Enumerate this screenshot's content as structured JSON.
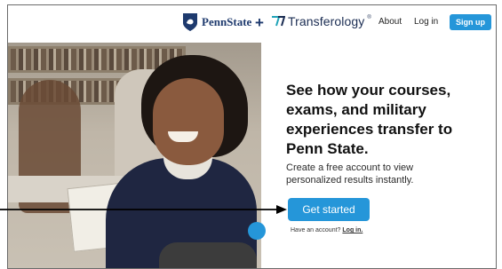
{
  "header": {
    "partner_name": "PennState",
    "plus": "+",
    "brand_name": "Transferology",
    "brand_mark": "®",
    "nav": {
      "about": "About",
      "login": "Log in"
    },
    "signup_label": "Sign up"
  },
  "hero": {
    "headline": "See how your courses, exams, and military experiences transfer to Penn State.",
    "subtext": "Create a free account to view personalized results instantly.",
    "cta_label": "Get started",
    "have_account": "Have an account?",
    "login_link": "Log in."
  },
  "colors": {
    "accent": "#2596d9",
    "penn_blue": "#1e3a6e"
  },
  "icons": [
    "penn-state-shield-icon",
    "transferology-logo-icon",
    "arrow-annotation"
  ]
}
